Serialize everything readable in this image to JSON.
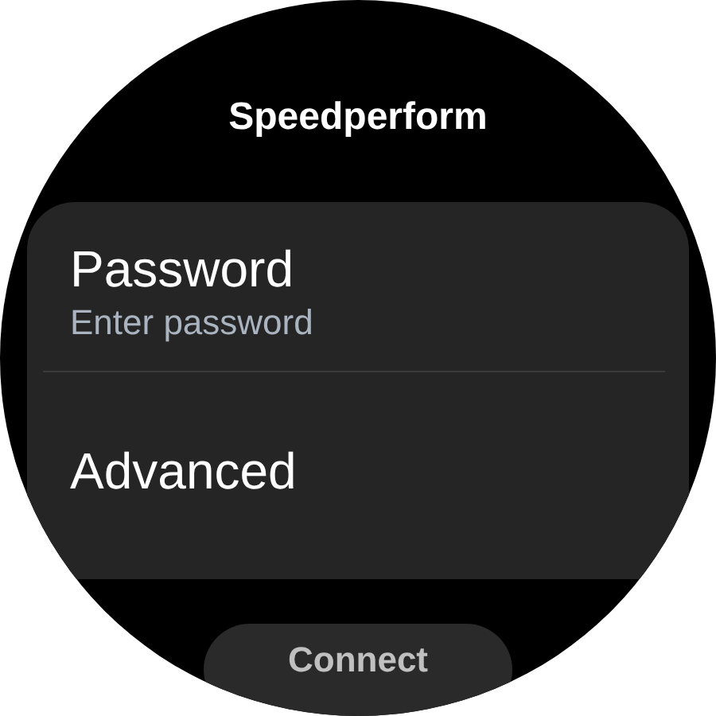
{
  "title": "Speedperform",
  "items": [
    {
      "label": "Password",
      "sublabel": "Enter password"
    },
    {
      "label": "Advanced"
    }
  ],
  "button": "Connect"
}
